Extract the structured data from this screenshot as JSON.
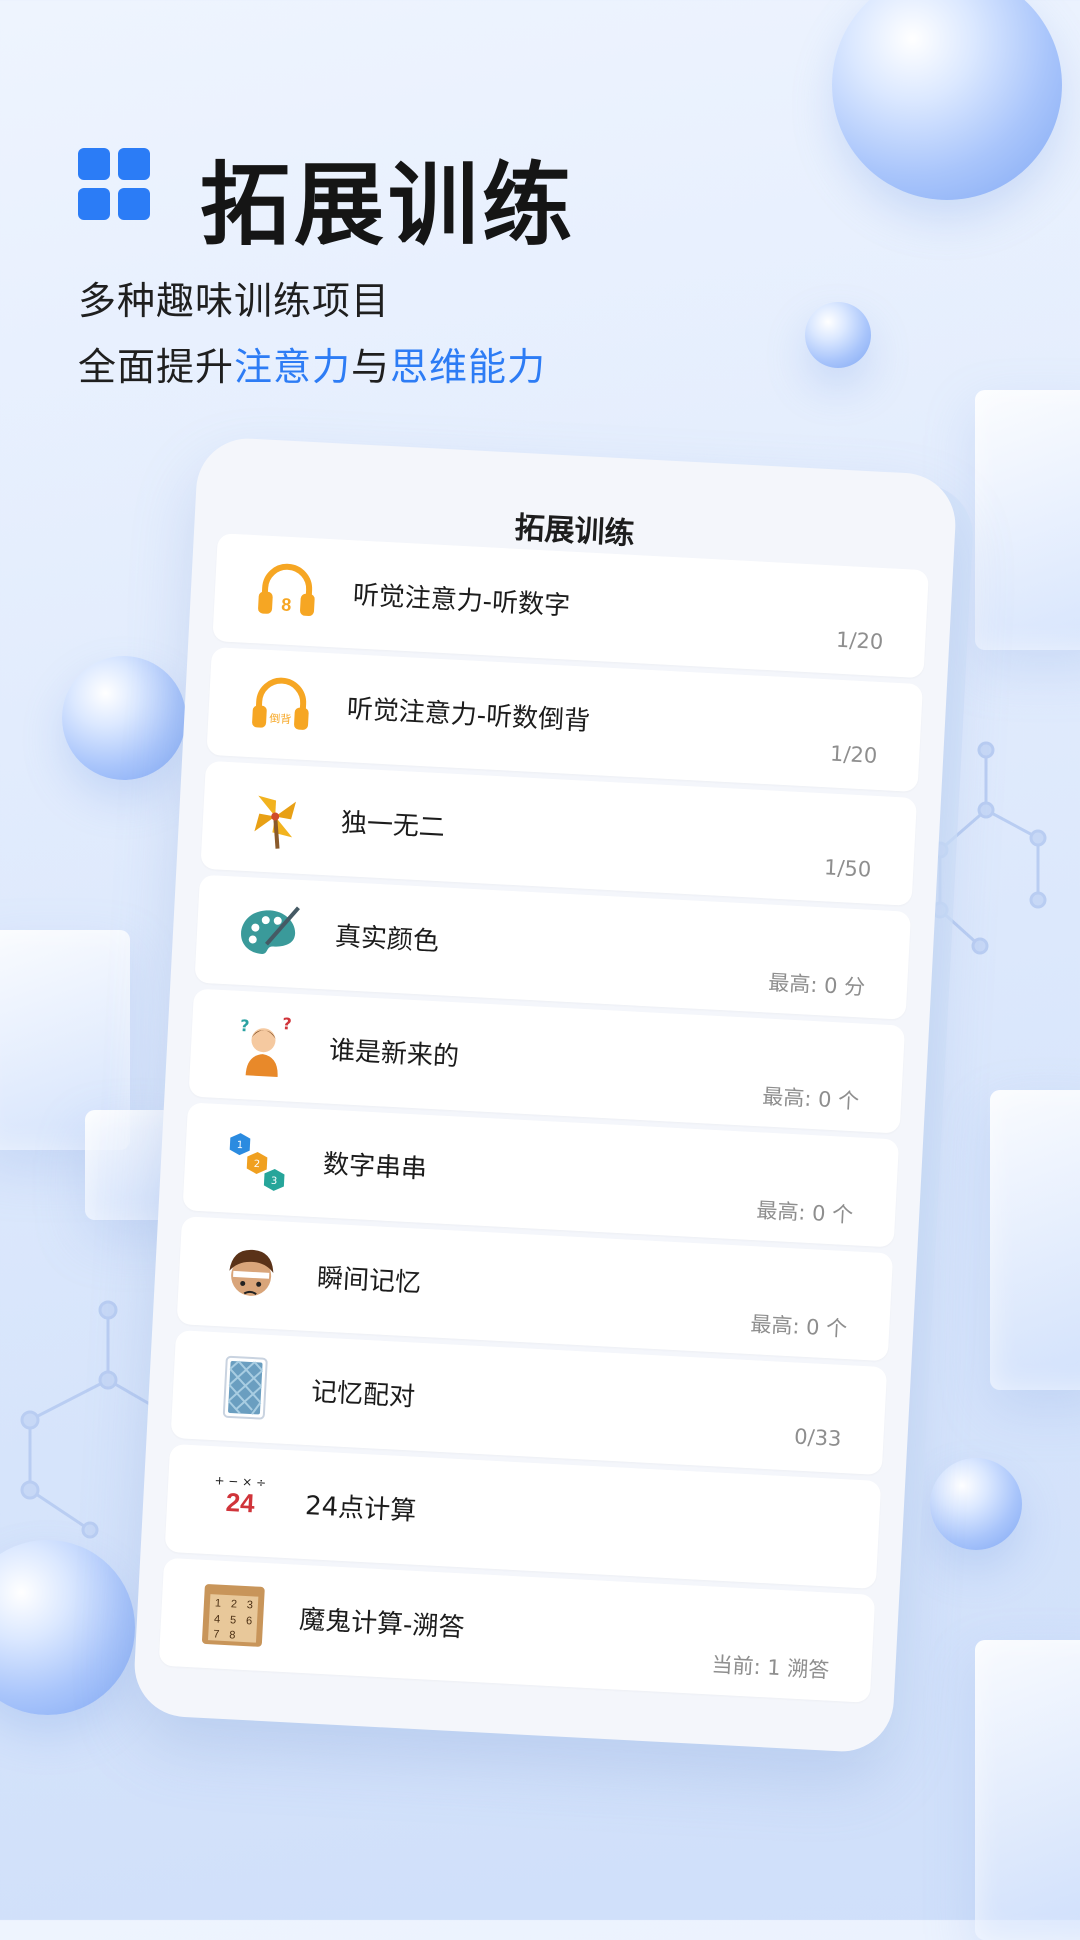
{
  "header": {
    "title": "拓展训练",
    "subtitle_line1": "多种趣味训练项目",
    "subtitle_line2_pre": "全面提升",
    "subtitle_line2_hl1": "注意力",
    "subtitle_line2_mid": "与",
    "subtitle_line2_hl2": "思维能力"
  },
  "phone": {
    "title": "拓展训练",
    "items": [
      {
        "label": "听觉注意力-听数字",
        "stat": "1/20",
        "icon": "headphones-8-icon"
      },
      {
        "label": "听觉注意力-听数倒背",
        "stat": "1/20",
        "icon": "headphones-reverse-icon"
      },
      {
        "label": "独一无二",
        "stat": "1/50",
        "icon": "pinwheel-icon"
      },
      {
        "label": "真实颜色",
        "stat": "最高: 0 分",
        "icon": "palette-icon"
      },
      {
        "label": "谁是新来的",
        "stat": "最高: 0 个",
        "icon": "confused-person-icon"
      },
      {
        "label": "数字串串",
        "stat": "最高: 0 个",
        "icon": "number-hexagons-icon"
      },
      {
        "label": "瞬间记忆",
        "stat": "最高: 0 个",
        "icon": "character-face-icon"
      },
      {
        "label": "记忆配对",
        "stat": "0/33",
        "icon": "card-back-icon"
      },
      {
        "label": "24点计算",
        "stat": "",
        "icon": "math-24-icon"
      },
      {
        "label": "魔鬼计算-溯答",
        "stat": "当前: 1 溯答",
        "icon": "number-puzzle-icon"
      }
    ],
    "icon_badges": {
      "headphones_digit": "8",
      "headphones_text": "倒背",
      "math_number": "24",
      "math_ops": "+ − × ÷",
      "hex_numbers": [
        "1",
        "2",
        "3"
      ],
      "puzzle_numbers": [
        "1",
        "2",
        "3",
        "4",
        "5",
        "6",
        "7",
        "8"
      ]
    }
  },
  "colors": {
    "accent": "#2d7cf5",
    "logo": "#2b7cf6",
    "headphones": "#f6a623"
  }
}
